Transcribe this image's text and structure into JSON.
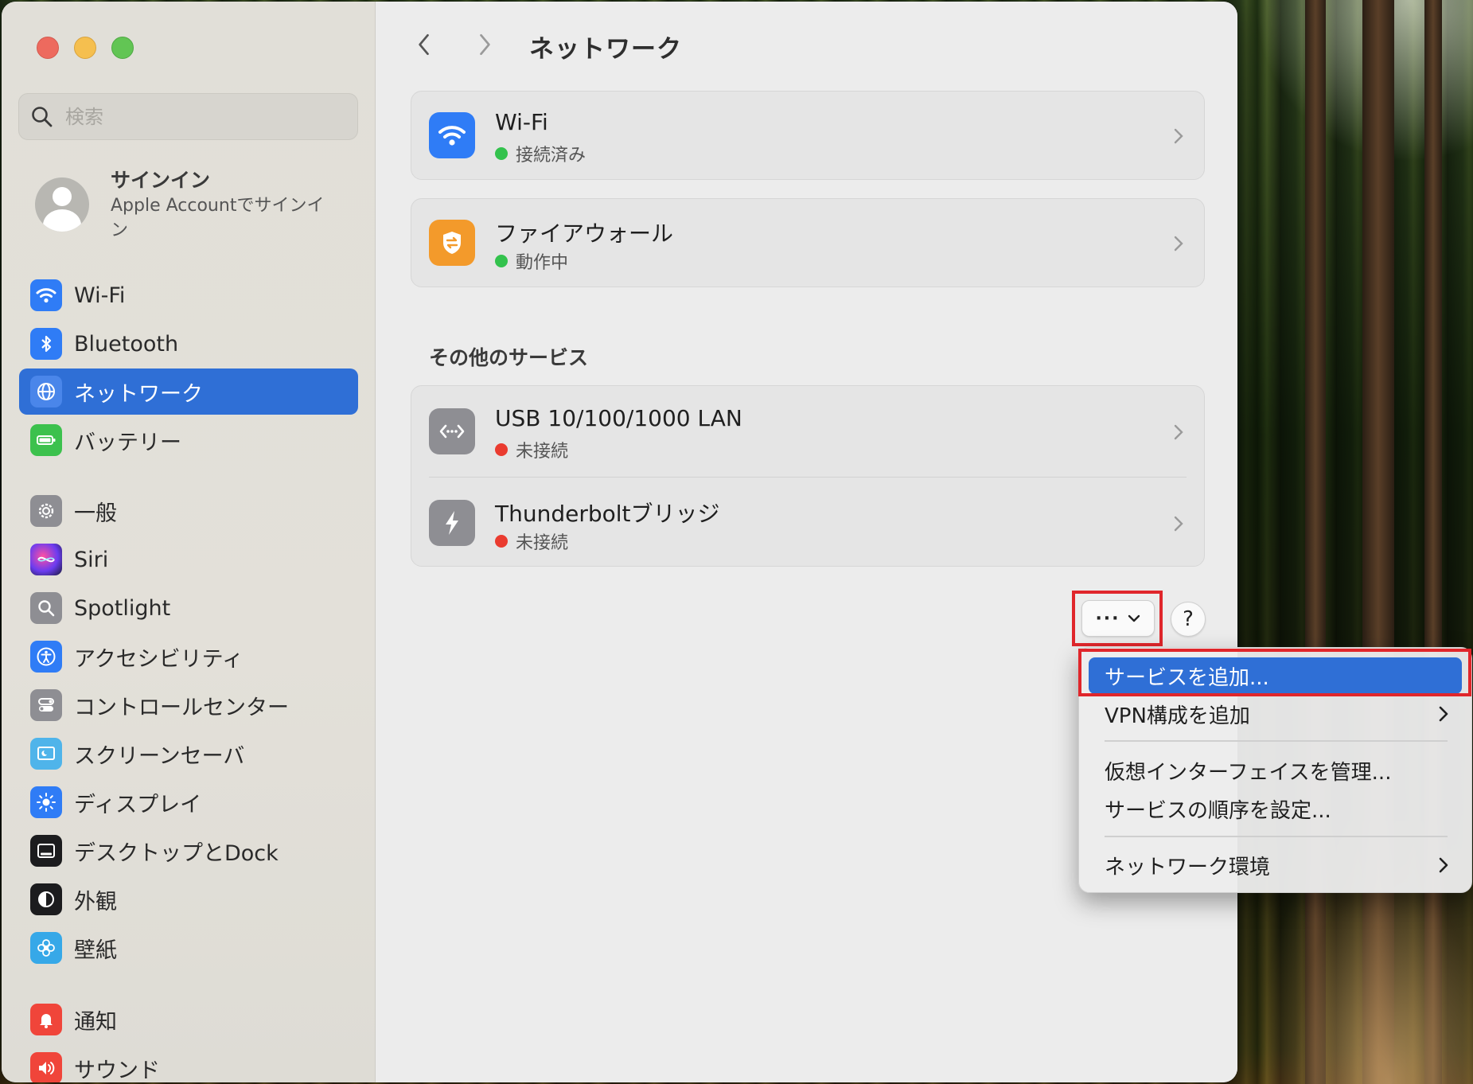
{
  "window": {
    "title": "ネットワーク"
  },
  "sidebar": {
    "search_placeholder": "検索",
    "account": {
      "title": "サインイン",
      "subtitle": "Apple Accountでサインイン"
    },
    "items": [
      {
        "label": "Wi-Fi",
        "icon": "wifi-icon",
        "color": "#2f7cf6",
        "active": false
      },
      {
        "label": "Bluetooth",
        "icon": "bluetooth-icon",
        "color": "#2f7cf6",
        "active": false
      },
      {
        "label": "ネットワーク",
        "icon": "globe-icon",
        "color": "#2f7cf6",
        "active": true
      },
      {
        "label": "バッテリー",
        "icon": "battery-icon",
        "color": "#3cc14d",
        "active": false
      },
      {
        "label": "一般",
        "icon": "gear-icon",
        "color": "#8e8e93",
        "active": false
      },
      {
        "label": "Siri",
        "icon": "siri-icon",
        "color": "#3a3a8c",
        "active": false
      },
      {
        "label": "Spotlight",
        "icon": "magnifier-icon",
        "color": "#8e8e93",
        "active": false
      },
      {
        "label": "アクセシビリティ",
        "icon": "accessibility-icon",
        "color": "#2f7cf6",
        "active": false
      },
      {
        "label": "コントロールセンター",
        "icon": "control-center-icon",
        "color": "#8e8e93",
        "active": false
      },
      {
        "label": "スクリーンセーバ",
        "icon": "screensaver-icon",
        "color": "#4fb4ea",
        "active": false
      },
      {
        "label": "ディスプレイ",
        "icon": "display-icon",
        "color": "#2f7cf6",
        "active": false
      },
      {
        "label": "デスクトップとDock",
        "icon": "dock-icon",
        "color": "#1c1c1e",
        "active": false
      },
      {
        "label": "外観",
        "icon": "appearance-icon",
        "color": "#1c1c1e",
        "active": false
      },
      {
        "label": "壁紙",
        "icon": "wallpaper-icon",
        "color": "#36a8e8",
        "active": false
      },
      {
        "label": "通知",
        "icon": "bell-icon",
        "color": "#f0453a",
        "active": false
      },
      {
        "label": "サウンド",
        "icon": "speaker-icon",
        "color": "#f0453a",
        "active": false
      }
    ]
  },
  "main": {
    "title": "ネットワーク",
    "primary_services": [
      {
        "name": "Wi-Fi",
        "status": "接続済み",
        "status_color": "#33c24d",
        "icon": "wifi-icon",
        "icon_color": "#2f7cf6"
      },
      {
        "name": "ファイアウォール",
        "status": "動作中",
        "status_color": "#33c24d",
        "icon": "firewall-shield-icon",
        "icon_color": "#f39a2b"
      }
    ],
    "other_services_title": "その他のサービス",
    "other_services": [
      {
        "name": "USB 10/100/1000 LAN",
        "status": "未接続",
        "status_color": "#ea3b2f",
        "icon": "ethernet-icon",
        "icon_color": "#8e8e93"
      },
      {
        "name": "Thunderboltブリッジ",
        "status": "未接続",
        "status_color": "#ea3b2f",
        "icon": "thunderbolt-icon",
        "icon_color": "#8e8e93"
      }
    ],
    "more_button_label": "···",
    "help_button_label": "?"
  },
  "menu": {
    "items": [
      {
        "label": "サービスを追加...",
        "selected": true,
        "submenu": false
      },
      {
        "label": "VPN構成を追加",
        "selected": false,
        "submenu": true
      },
      {
        "label": "仮想インターフェイスを管理...",
        "selected": false,
        "submenu": false
      },
      {
        "label": "サービスの順序を設定...",
        "selected": false,
        "submenu": false
      },
      {
        "label": "ネットワーク環境",
        "selected": false,
        "submenu": true
      }
    ]
  },
  "annotation_color": "#e0262b"
}
